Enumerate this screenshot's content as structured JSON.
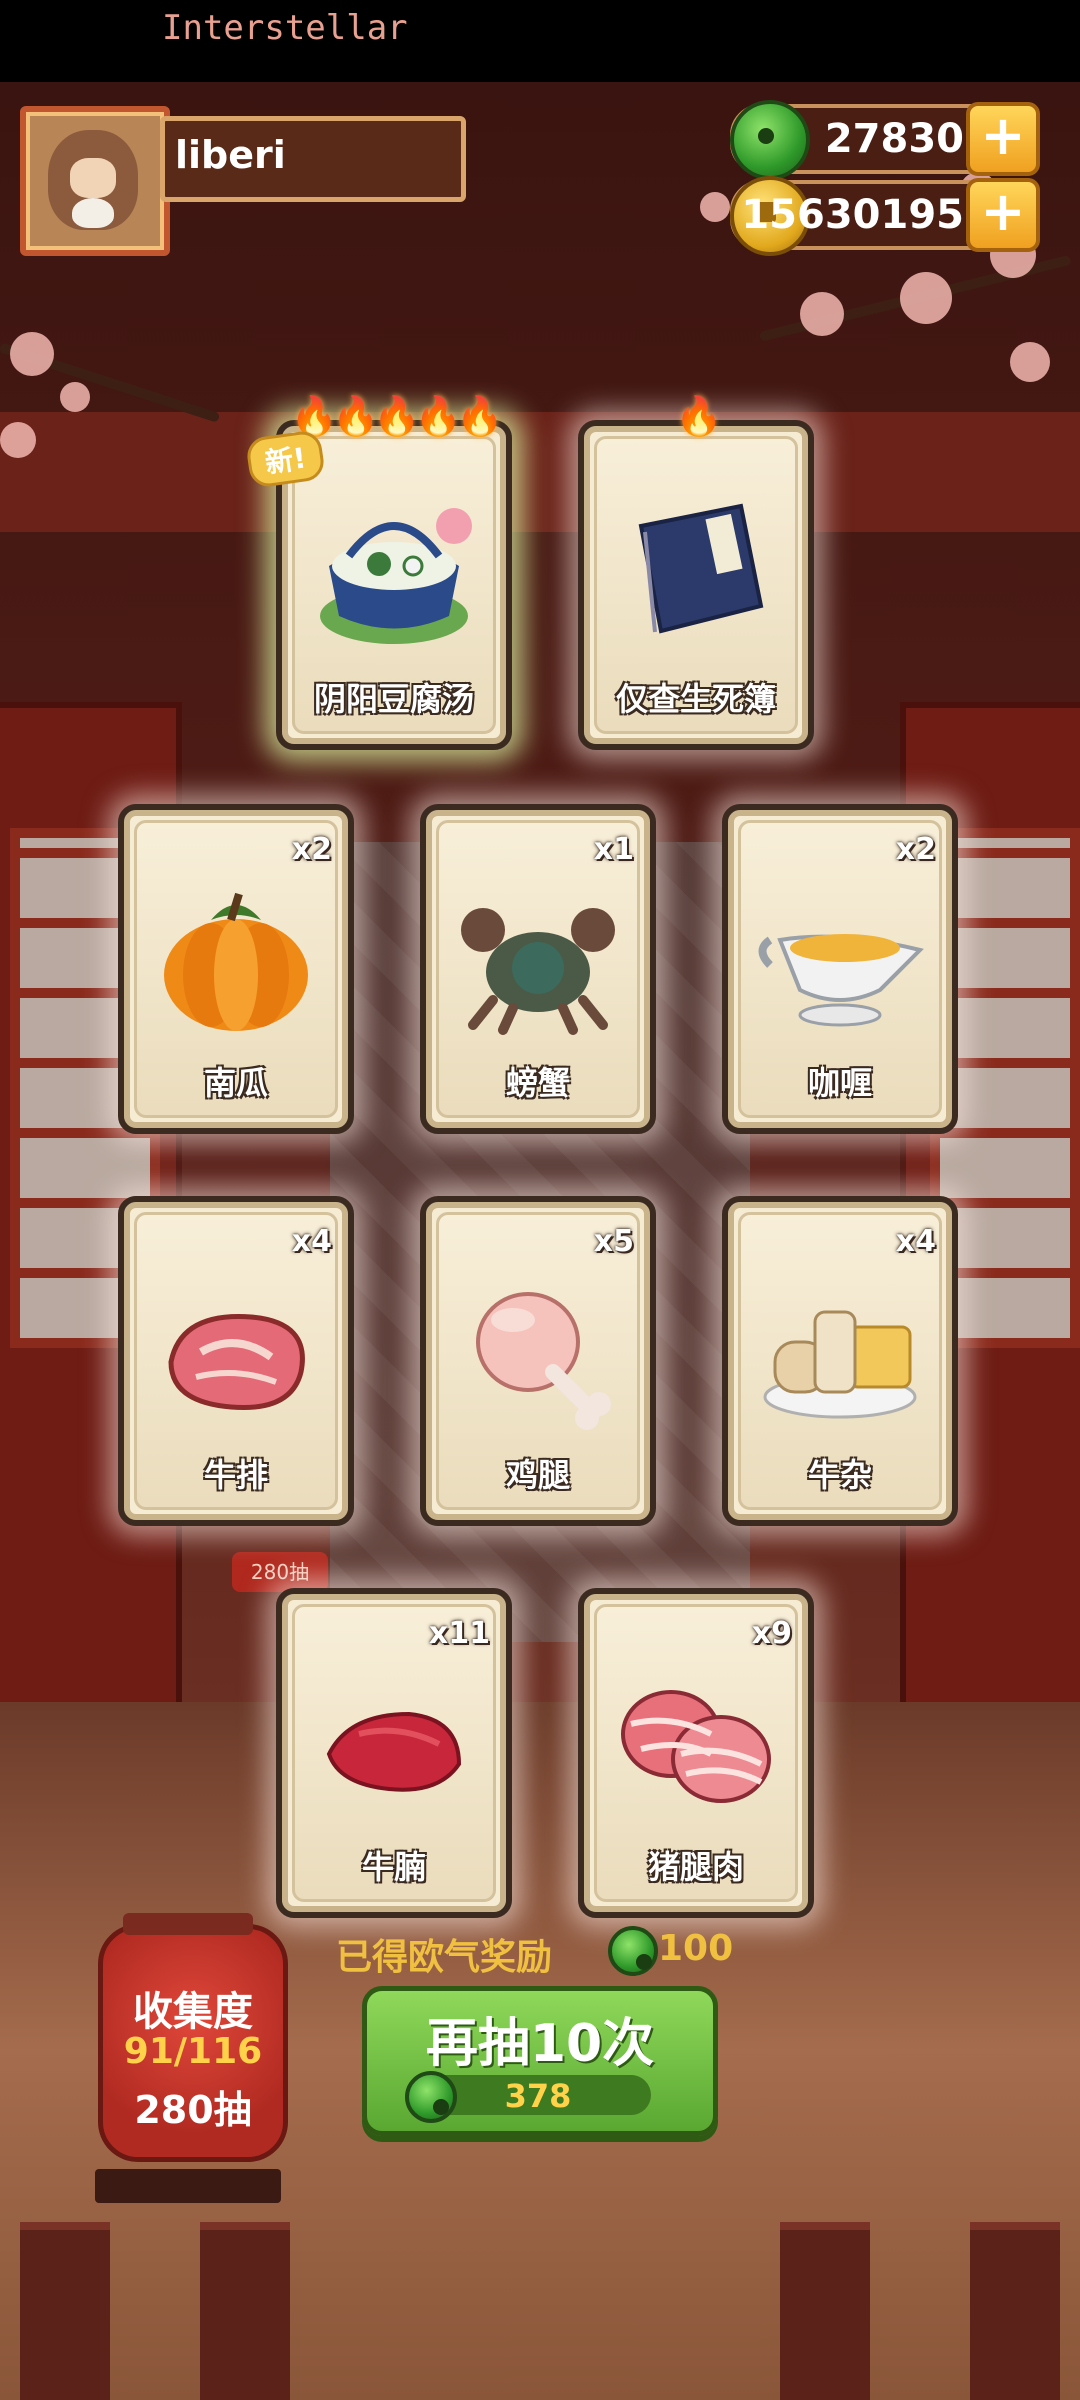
{
  "status_bar": {
    "title": "Interstellar"
  },
  "player": {
    "name": "liberi"
  },
  "currencies": [
    {
      "icon": "jade-icon",
      "amount": "27830"
    },
    {
      "icon": "coin-icon",
      "amount": "15630195"
    }
  ],
  "featured_cards": [
    {
      "label": "阴阳豆腐汤",
      "flames": "🔥🔥🔥🔥🔥",
      "tag": "新!"
    },
    {
      "label": "仅查生死簿",
      "flames": "🔥"
    }
  ],
  "cards": [
    {
      "label": "南瓜",
      "count": "x2"
    },
    {
      "label": "螃蟹",
      "count": "x1"
    },
    {
      "label": "咖喱",
      "count": "x2"
    },
    {
      "label": "牛排",
      "count": "x4"
    },
    {
      "label": "鸡腿",
      "count": "x5"
    },
    {
      "label": "牛杂",
      "count": "x4"
    },
    {
      "label": "牛腩",
      "count": "x11"
    },
    {
      "label": "猪腿肉",
      "count": "x9"
    }
  ],
  "collection": {
    "title": "收集度",
    "progress": "91/116",
    "pulls": "280抽"
  },
  "background_badge": "280抽",
  "reward": {
    "text": "已得欧气奖励",
    "amount": "100"
  },
  "draw_button": {
    "label": "再抽10次",
    "cost": "378"
  },
  "colors": {
    "draw_button_green": "#5aa832",
    "accent_gold": "#f0c040",
    "jade_green": "#2f9a2a"
  }
}
